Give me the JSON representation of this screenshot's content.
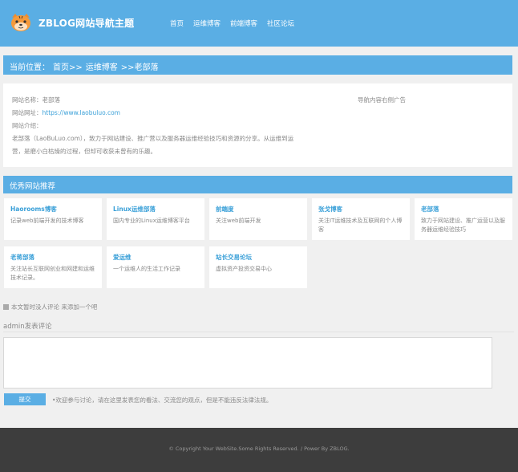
{
  "header": {
    "site_title": "ZBLOG网站导航主题",
    "nav": [
      "首页",
      "运维博客",
      "前端博客",
      "社区论坛"
    ],
    "logo_icon": "tiger-face-icon"
  },
  "breadcrumb": {
    "prefix": "当前位置：",
    "home": "首页>>",
    "category": "运维博客",
    "current": ">>老部落"
  },
  "site_info": {
    "name_label": "网站名称：",
    "name_value": "老部落",
    "url_label": "网站网址：",
    "url_value": "https://www.laobuluo.com",
    "intro_label": "网站介绍：",
    "intro_text": "老部落（LaoBuLuo.com），致力于网站建设、推广营以及服务器运维经验技巧和资源的分享。从运维到运营，是磨小白枯燥的过程，但却可收获未曾有的乐趣。",
    "ad_text": "导航内容右侧广告"
  },
  "recommend": {
    "title": "优秀网站推荐",
    "cards": [
      {
        "title": "Haorooms博客",
        "desc": "记录web前端开发的技术博客"
      },
      {
        "title": "Linux运维部落",
        "desc": "国内专业的Linux运维博客平台"
      },
      {
        "title": "前端度",
        "desc": "关注web前端开发"
      },
      {
        "title": "张戈博客",
        "desc": "关注IT运维技术及互联网的个人博客"
      },
      {
        "title": "老部落",
        "desc": "致力于网站建设、推广运营以及服务器运维经验技巧"
      },
      {
        "title": "老蒋部落",
        "desc": "关注站长互联网创业和网建和运维技术记录。"
      },
      {
        "title": "爱运维",
        "desc": "一个运维人的生活工作记录"
      },
      {
        "title": "站长交易论坛",
        "desc": "虚拟资产投资交易中心"
      }
    ]
  },
  "comments": {
    "none_text": "本文暂时没人评论 来添加一个吧",
    "post_heading": "admin发表评论",
    "submit_label": "提交",
    "hint": "•欢迎参与讨论，请在这里发表您的看法、交流您的观点，但是不能违反法律法规。"
  },
  "footer": {
    "copyright": "© Copyright Your WebSite.Some Rights Reserved. / Power By ZBLOG."
  }
}
